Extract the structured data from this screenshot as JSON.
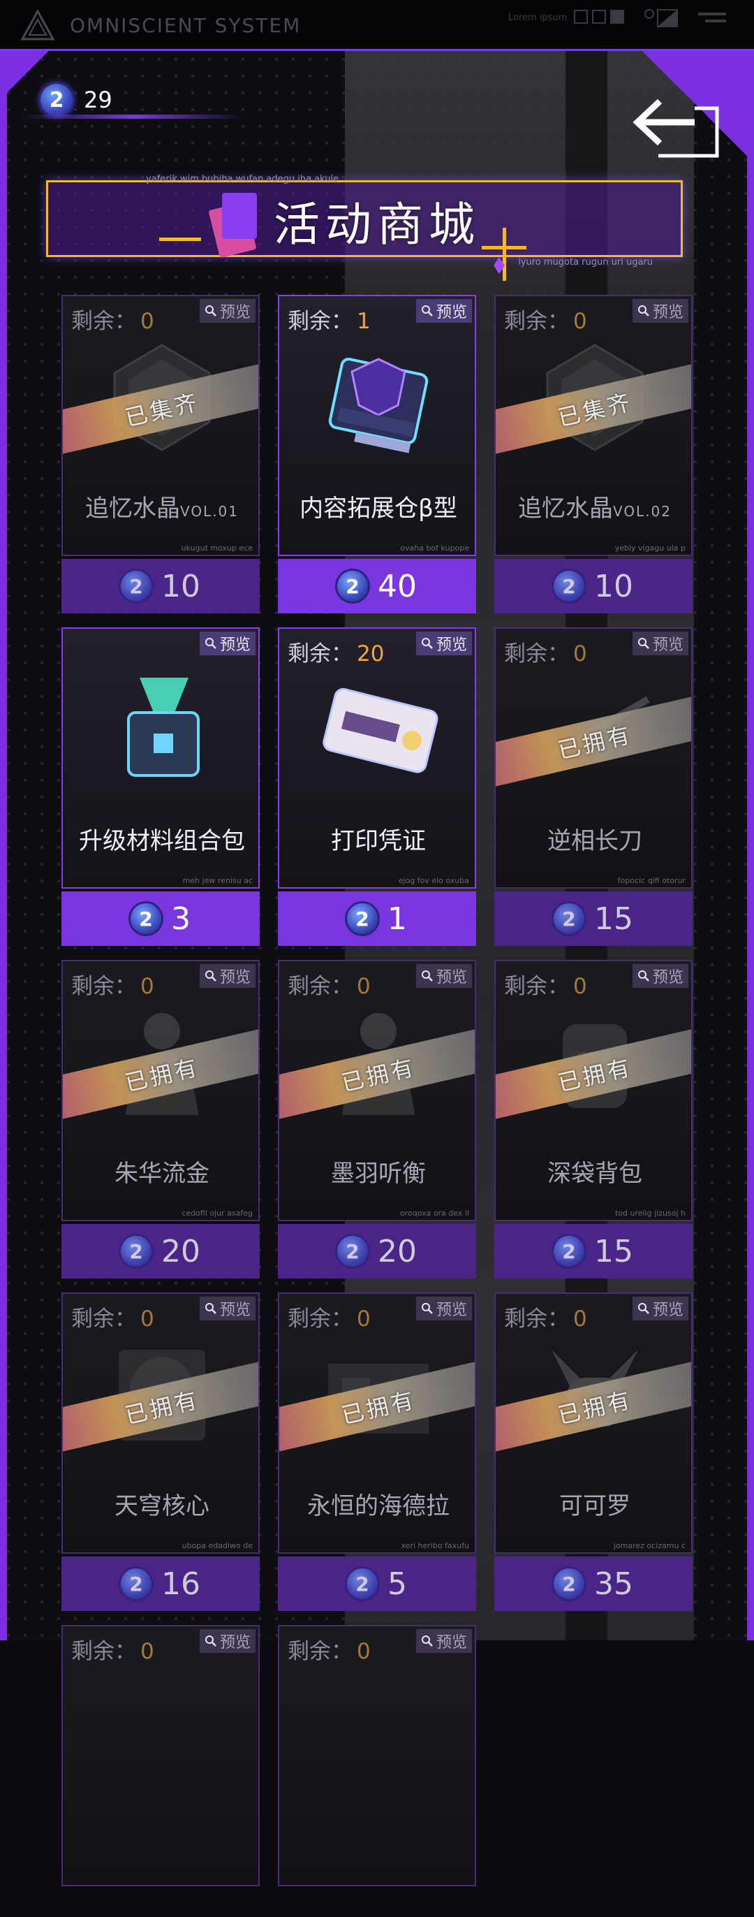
{
  "system": {
    "name": "OMNISCIENT  SYSTEM",
    "lorem": "Lorem ipsum"
  },
  "currency": {
    "amount": "29",
    "icon": "currency-coin-icon"
  },
  "title": {
    "text": "活动商城",
    "subtext_top": "yaferik wim bubiha wufan adegu iha akule",
    "subtext_bottom": "iyuro mugota rugun uri ugaru"
  },
  "labels": {
    "remaining": "剩余：",
    "preview": "预览",
    "collected": "已集齐",
    "owned": "已拥有"
  },
  "items": [
    {
      "remaining": "0",
      "name": "追忆水晶",
      "suffix": "VOL.01",
      "tag": "ukugut moxup ece",
      "price": "10",
      "stamp": "已集齐",
      "state": "dim",
      "icon": "crystal-icon"
    },
    {
      "remaining": "1",
      "name": "内容拓展仓β型",
      "suffix": "",
      "tag": "ovaha bof kupope",
      "price": "40",
      "stamp": "",
      "state": "on",
      "icon": "chip-module-icon"
    },
    {
      "remaining": "0",
      "name": "追忆水晶",
      "suffix": "VOL.02",
      "tag": "yebly vigagu ula p",
      "price": "10",
      "stamp": "已集齐",
      "state": "dim",
      "icon": "crystal-icon"
    },
    {
      "remaining": "",
      "name": "升级材料组合包",
      "suffix": "",
      "tag": "meh jew renisu ac",
      "price": "3",
      "stamp": "",
      "state": "on",
      "icon": "material-pack-icon"
    },
    {
      "remaining": "20",
      "name": "打印凭证",
      "suffix": "",
      "tag": "ejog fov elo oxuba",
      "price": "1",
      "stamp": "",
      "state": "on",
      "icon": "ticket-icon"
    },
    {
      "remaining": "0",
      "name": "逆相长刀",
      "suffix": "",
      "tag": "fopocic qifi otorur",
      "price": "15",
      "stamp": "已拥有",
      "state": "dim",
      "icon": "blade-icon"
    },
    {
      "remaining": "0",
      "name": "朱华流金",
      "suffix": "",
      "tag": "cedofil ojur asafeg",
      "price": "20",
      "stamp": "已拥有",
      "state": "dim",
      "icon": "outfit-icon"
    },
    {
      "remaining": "0",
      "name": "墨羽听衡",
      "suffix": "",
      "tag": "oroqoxa ora dex il",
      "price": "20",
      "stamp": "已拥有",
      "state": "dim",
      "icon": "outfit-icon"
    },
    {
      "remaining": "0",
      "name": "深袋背包",
      "suffix": "",
      "tag": "tod urelig jizusoj h",
      "price": "15",
      "stamp": "已拥有",
      "state": "dim",
      "icon": "backpack-icon"
    },
    {
      "remaining": "0",
      "name": "天穹核心",
      "suffix": "",
      "tag": "ubopa edadiwo de",
      "price": "16",
      "stamp": "已拥有",
      "state": "dim",
      "icon": "core-icon"
    },
    {
      "remaining": "0",
      "name": "永恒的海德拉",
      "suffix": "",
      "tag": "xeri heribo faxufu",
      "price": "5",
      "stamp": "已拥有",
      "state": "dim",
      "icon": "scene-icon"
    },
    {
      "remaining": "0",
      "name": "可可罗",
      "suffix": "",
      "tag": "jomarez ocizamu c",
      "price": "35",
      "stamp": "已拥有",
      "state": "dim",
      "icon": "robot-icon"
    },
    {
      "remaining": "0",
      "name": "",
      "suffix": "",
      "tag": "",
      "price": "",
      "stamp": "",
      "state": "dim",
      "icon": ""
    },
    {
      "remaining": "0",
      "name": "",
      "suffix": "",
      "tag": "",
      "price": "",
      "stamp": "",
      "state": "dim",
      "icon": ""
    }
  ]
}
